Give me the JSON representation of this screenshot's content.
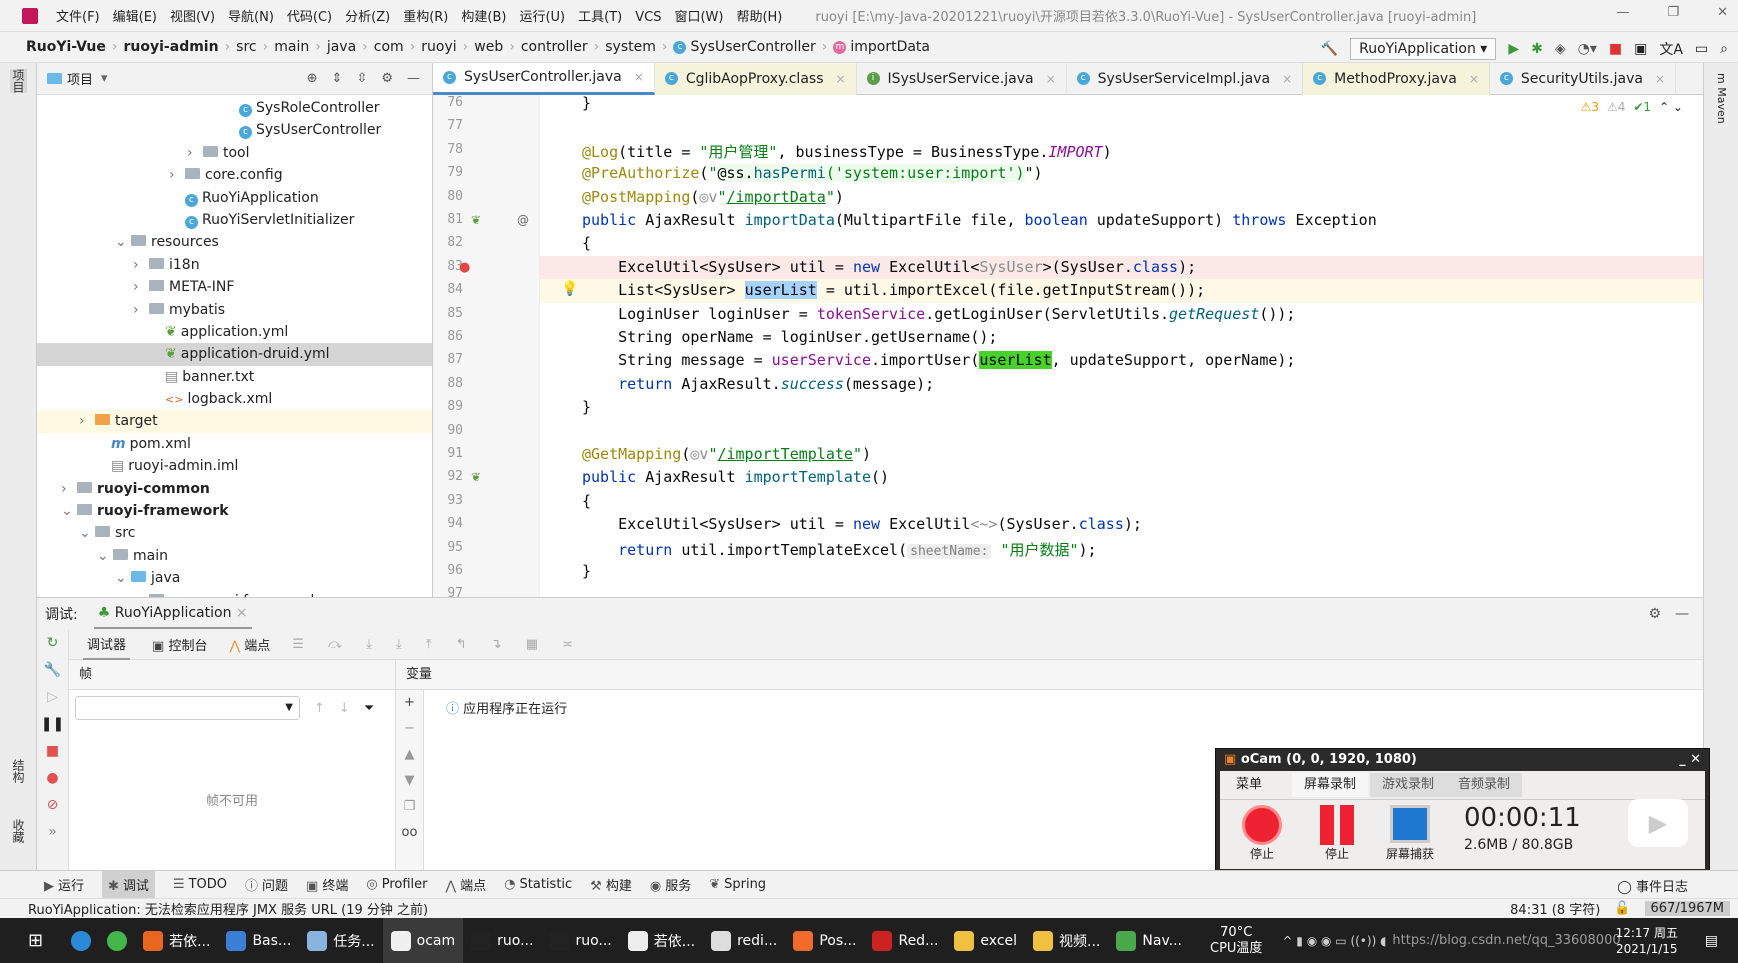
{
  "titlebar": {
    "menus": [
      "文件(F)",
      "编辑(E)",
      "视图(V)",
      "导航(N)",
      "代码(C)",
      "分析(Z)",
      "重构(R)",
      "构建(B)",
      "运行(U)",
      "工具(T)",
      "VCS",
      "窗口(W)",
      "帮助(H)"
    ],
    "title": "ruoyi [E:\\my-Java-20201221\\ruoyi\\开源项目若依3.3.0\\RuoYi-Vue] - SysUserController.java [ruoyi-admin]"
  },
  "breadcrumb": [
    "RuoYi-Vue",
    "ruoyi-admin",
    "src",
    "main",
    "java",
    "com",
    "ruoyi",
    "web",
    "controller",
    "system",
    "SysUserController",
    "importData"
  ],
  "run_config": "RuoYiApplication",
  "project": {
    "title": "项目",
    "side_label": "项目",
    "items": [
      {
        "label": "SysRoleController",
        "indent": 186,
        "type": "class"
      },
      {
        "label": "SysUserController",
        "indent": 186,
        "type": "class"
      },
      {
        "label": "tool",
        "indent": 150,
        "type": "folder",
        "arrow": ">"
      },
      {
        "label": "core.config",
        "indent": 132,
        "type": "folder",
        "arrow": ">"
      },
      {
        "label": "RuoYiApplication",
        "indent": 132,
        "type": "class"
      },
      {
        "label": "RuoYiServletInitializer",
        "indent": 132,
        "type": "class"
      },
      {
        "label": "resources",
        "indent": 78,
        "type": "folder",
        "arrow": "v"
      },
      {
        "label": "i18n",
        "indent": 96,
        "type": "folder",
        "arrow": ">"
      },
      {
        "label": "META-INF",
        "indent": 96,
        "type": "folder",
        "arrow": ">"
      },
      {
        "label": "mybatis",
        "indent": 96,
        "type": "folder",
        "arrow": ">"
      },
      {
        "label": "application.yml",
        "indent": 112,
        "type": "yml"
      },
      {
        "label": "application-druid.yml",
        "indent": 112,
        "type": "yml",
        "selected": true
      },
      {
        "label": "banner.txt",
        "indent": 112,
        "type": "file"
      },
      {
        "label": "logback.xml",
        "indent": 112,
        "type": "xml"
      },
      {
        "label": "target",
        "indent": 42,
        "type": "folder-orange",
        "arrow": ">",
        "highlight": true
      },
      {
        "label": "pom.xml",
        "indent": 58,
        "type": "maven"
      },
      {
        "label": "ruoyi-admin.iml",
        "indent": 58,
        "type": "file"
      },
      {
        "label": "ruoyi-common",
        "indent": 24,
        "type": "module",
        "arrow": ">",
        "bold": true
      },
      {
        "label": "ruoyi-framework",
        "indent": 24,
        "type": "module",
        "arrow": "v",
        "bold": true
      },
      {
        "label": "src",
        "indent": 42,
        "type": "folder",
        "arrow": "v"
      },
      {
        "label": "main",
        "indent": 60,
        "type": "folder",
        "arrow": "v"
      },
      {
        "label": "java",
        "indent": 78,
        "type": "folder-blue",
        "arrow": "v"
      },
      {
        "label": "com.ruoyi.framework",
        "indent": 96,
        "type": "folder",
        "arrow": "v"
      }
    ]
  },
  "tabs": [
    {
      "label": "SysUserController.java",
      "icon": "c",
      "active": true
    },
    {
      "label": "CglibAopProxy.class",
      "icon": "c",
      "cls": true
    },
    {
      "label": "ISysUserService.java",
      "icon": "i"
    },
    {
      "label": "SysUserServiceImpl.java",
      "icon": "c"
    },
    {
      "label": "MethodProxy.java",
      "icon": "c",
      "cls": true
    },
    {
      "label": "SecurityUtils.java",
      "icon": "c"
    }
  ],
  "inspections": {
    "warnings": "3",
    "weak": "4",
    "ok": "1"
  },
  "code": [
    {
      "n": "76",
      "t": [
        [
          "}",
          ""
        ]
      ]
    },
    {
      "n": "77",
      "t": []
    },
    {
      "n": "78",
      "t": [
        [
          "@Log",
          "ann"
        ],
        [
          "(title = ",
          ""
        ],
        [
          "\"用户管理\"",
          "str"
        ],
        [
          ", businessType = BusinessType.",
          ""
        ],
        [
          "IMPORT",
          "fld it"
        ],
        [
          ")",
          ""
        ]
      ]
    },
    {
      "n": "79",
      "t": [
        [
          "@PreAuthorize",
          "ann"
        ],
        [
          "(",
          ""
        ],
        [
          "\"",
          "str"
        ],
        [
          "@ss.",
          "strbg"
        ],
        [
          "hasPermi",
          "strbg mth"
        ],
        [
          "('system:user:import')",
          "strbg str"
        ],
        [
          "\")",
          ""
        ]
      ]
    },
    {
      "n": "80",
      "t": [
        [
          "@PostMapping",
          "ann"
        ],
        [
          "(",
          ""
        ],
        [
          "◎v",
          "gray"
        ],
        [
          "\"",
          "str"
        ],
        [
          "/importData",
          "link"
        ],
        [
          "\"",
          "str"
        ],
        [
          ")",
          ""
        ]
      ]
    },
    {
      "n": "81",
      "t": [
        [
          "public ",
          "kw"
        ],
        [
          "AjaxResult ",
          ""
        ],
        [
          "importData",
          "mth"
        ],
        [
          "(MultipartFile file, ",
          ""
        ],
        [
          "boolean ",
          "kw"
        ],
        [
          "updateSupport) ",
          ""
        ],
        [
          "throws ",
          "kw"
        ],
        [
          "Exception",
          ""
        ]
      ]
    },
    {
      "n": "82",
      "t": [
        [
          "{",
          ""
        ]
      ]
    },
    {
      "n": "83",
      "t": [
        [
          "    ExcelUtil<SysUser> util = ",
          ""
        ],
        [
          "new ",
          "kw"
        ],
        [
          "ExcelUtil<",
          ""
        ],
        [
          "SysUser",
          "gray"
        ],
        [
          ">(SysUser.",
          ""
        ],
        [
          "class",
          "kw"
        ],
        [
          ");",
          ""
        ]
      ],
      "band": "#fbe9e7"
    },
    {
      "n": "84",
      "t": [
        [
          "    List<SysUser> ",
          ""
        ],
        [
          "userList",
          "selw"
        ],
        [
          " = util.importExcel(file.getInputStream());",
          ""
        ]
      ],
      "band": "#fdf9e6"
    },
    {
      "n": "85",
      "t": [
        [
          "    LoginUser loginUser = ",
          ""
        ],
        [
          "tokenService",
          "fld"
        ],
        [
          ".getLoginUser(ServletUtils.",
          ""
        ],
        [
          "getRequest",
          "mth it"
        ],
        [
          "());",
          ""
        ]
      ]
    },
    {
      "n": "86",
      "t": [
        [
          "    String operName = loginUser.getUsername();",
          ""
        ]
      ]
    },
    {
      "n": "87",
      "t": [
        [
          "    String message = ",
          ""
        ],
        [
          "userService",
          "fld"
        ],
        [
          ".importUser(",
          ""
        ],
        [
          "userList",
          "grn"
        ],
        [
          ", updateSupport, operName);",
          ""
        ]
      ]
    },
    {
      "n": "88",
      "t": [
        [
          "    ",
          ""
        ],
        [
          "return ",
          "kw"
        ],
        [
          "AjaxResult.",
          ""
        ],
        [
          "success",
          "mth it"
        ],
        [
          "(message);",
          ""
        ]
      ]
    },
    {
      "n": "89",
      "t": [
        [
          "}",
          ""
        ]
      ]
    },
    {
      "n": "90",
      "t": []
    },
    {
      "n": "91",
      "t": [
        [
          "@GetMapping",
          "ann"
        ],
        [
          "(",
          ""
        ],
        [
          "◎v",
          "gray"
        ],
        [
          "\"",
          "str"
        ],
        [
          "/importTemplate",
          "link"
        ],
        [
          "\"",
          "str"
        ],
        [
          ")",
          ""
        ]
      ]
    },
    {
      "n": "92",
      "t": [
        [
          "public ",
          "kw"
        ],
        [
          "AjaxResult ",
          ""
        ],
        [
          "importTemplate",
          "mth"
        ],
        [
          "()",
          ""
        ]
      ]
    },
    {
      "n": "93",
      "t": [
        [
          "{",
          ""
        ]
      ]
    },
    {
      "n": "94",
      "t": [
        [
          "    ExcelUtil<SysUser> util = ",
          ""
        ],
        [
          "new ",
          "kw"
        ],
        [
          "ExcelUtil",
          ""
        ],
        [
          "<~>",
          "gray"
        ],
        [
          "(SysUser.",
          ""
        ],
        [
          "class",
          "kw"
        ],
        [
          ");",
          ""
        ]
      ]
    },
    {
      "n": "95",
      "t": [
        [
          "    ",
          ""
        ],
        [
          "return ",
          "kw"
        ],
        [
          "util.importTemplateExcel(",
          ""
        ],
        [
          "sheetName:",
          "hint"
        ],
        [
          " ",
          ""
        ],
        [
          "\"用户数据\"",
          "str"
        ],
        [
          ");",
          ""
        ]
      ]
    },
    {
      "n": "96",
      "t": [
        [
          "}",
          ""
        ]
      ]
    },
    {
      "n": "97",
      "t": []
    }
  ],
  "debug": {
    "label": "调试:",
    "session": "RuoYiApplication",
    "tabs": [
      "调试器",
      "控制台",
      "端点"
    ],
    "frames_header": "帧",
    "frames_empty": "帧不可用",
    "vars_header": "变量",
    "running_msg": "应用程序正在运行"
  },
  "left_side": [
    "结构",
    "收藏"
  ],
  "toolwindows": [
    "运行",
    "调试",
    "TODO",
    "问题",
    "终端",
    "Profiler",
    "端点",
    "Statistic",
    "构建",
    "服务",
    "Spring"
  ],
  "event_log": "事件日志",
  "status": {
    "message": "RuoYiApplication: 无法检索应用程序 JMX 服务 URL (19 分钟 之前)",
    "position": "84:31 (8 字符)",
    "memory": "667/1967M"
  },
  "ocam": {
    "title": "oCam (0, 0, 1920, 1080)",
    "tabs": [
      "菜单",
      "屏幕录制",
      "游戏录制",
      "音频录制"
    ],
    "buttons": [
      "停止",
      "停止",
      "屏幕捕获"
    ],
    "time": "00:00:11",
    "size": "2.6MB / 80.8GB"
  },
  "taskbar": {
    "items": [
      "若依...",
      "Bas...",
      "任务...",
      "ocam",
      "ruo...",
      "ruo...",
      "若依...",
      "redi...",
      "Pos...",
      "Red...",
      "excel",
      "视频...",
      "Nav..."
    ],
    "temp": "70°C",
    "temp_label": "CPU温度",
    "time": "12:17 周五",
    "date": "2021/1/15",
    "watermark": "https://blog.csdn.net/qq_33608000"
  }
}
